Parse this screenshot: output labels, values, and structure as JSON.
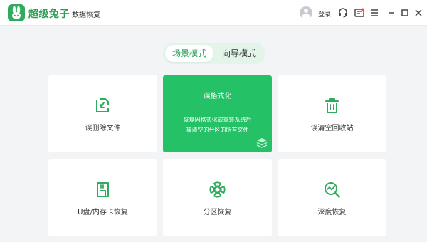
{
  "app": {
    "name": "超级兔子",
    "subtitle": "数据恢复"
  },
  "titlebar": {
    "login_label": "登录",
    "icons": [
      "avatar-icon",
      "support-icon",
      "feedback-icon",
      "menu-icon",
      "minimize-icon",
      "maximize-icon",
      "close-icon"
    ]
  },
  "mode_tabs": [
    {
      "label": "场景模式",
      "selected": true
    },
    {
      "label": "向导模式",
      "selected": false
    }
  ],
  "cards": {
    "deleted_files": {
      "label": "误删除文件",
      "icon": "file-recover-icon"
    },
    "format": {
      "title": "误格式化",
      "description": [
        "恢复因格式化或重装系统后",
        "被清空的分区的所有文件"
      ],
      "icon": "disk-stack-icon",
      "selected": true
    },
    "recycle_bin": {
      "label": "误清空回收站",
      "icon": "trash-icon"
    },
    "usb_card": {
      "label": "U盘/内存卡恢复",
      "icon": "sd-card-icon"
    },
    "partition": {
      "label": "分区恢复",
      "icon": "partition-icon"
    },
    "deep": {
      "label": "深度恢复",
      "icon": "deep-scan-icon"
    }
  },
  "colors": {
    "accent": "#25c166",
    "brand_green": "#2a9d52",
    "icon_green": "#2eab5c",
    "background": "#f3f4f6",
    "tab_bg": "#e2f5e8"
  }
}
